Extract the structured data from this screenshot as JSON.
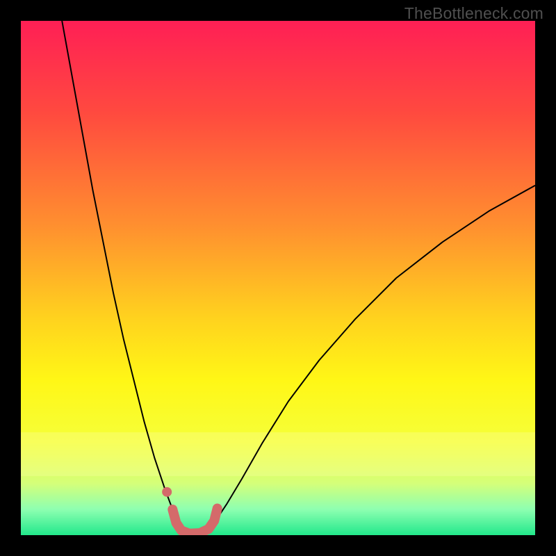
{
  "watermark": "TheBottleneck.com",
  "chart_data": {
    "type": "line",
    "title": "",
    "xlabel": "",
    "ylabel": "",
    "xlim": [
      0,
      100
    ],
    "ylim": [
      0,
      100
    ],
    "background_gradient": {
      "orientation": "vertical",
      "stops": [
        {
          "pos": 0.0,
          "color": "#ff1f55"
        },
        {
          "pos": 0.18,
          "color": "#ff4a3f"
        },
        {
          "pos": 0.4,
          "color": "#ff902f"
        },
        {
          "pos": 0.58,
          "color": "#ffd31e"
        },
        {
          "pos": 0.7,
          "color": "#fff716"
        },
        {
          "pos": 0.82,
          "color": "#f5ff3a"
        },
        {
          "pos": 0.9,
          "color": "#d4ff7a"
        },
        {
          "pos": 0.95,
          "color": "#8dffb1"
        },
        {
          "pos": 1.0,
          "color": "#22e88b"
        }
      ]
    },
    "series": [
      {
        "name": "left-branch",
        "stroke": "#000000",
        "stroke_width": 2,
        "x": [
          8,
          10,
          12,
          14,
          16,
          18,
          20,
          22,
          24,
          26,
          28,
          29.5,
          30.5
        ],
        "y": [
          100,
          89,
          78,
          67,
          57,
          47,
          38,
          30,
          22,
          15,
          9,
          5,
          3
        ]
      },
      {
        "name": "right-branch",
        "stroke": "#000000",
        "stroke_width": 2,
        "x": [
          38,
          40,
          43,
          47,
          52,
          58,
          65,
          73,
          82,
          91,
          100
        ],
        "y": [
          3,
          6,
          11,
          18,
          26,
          34,
          42,
          50,
          57,
          63,
          68
        ]
      },
      {
        "name": "highlight-band",
        "stroke": "#d46a6a",
        "stroke_width": 14,
        "linecap": "round",
        "x": [
          29.5,
          30.2,
          31.2,
          32.8,
          34.8,
          36.5,
          37.6,
          38.2
        ],
        "y": [
          5.0,
          2.4,
          0.9,
          0.3,
          0.4,
          1.2,
          2.8,
          5.2
        ]
      },
      {
        "name": "highlight-dot",
        "type": "scatter",
        "color": "#d46a6a",
        "radius": 7,
        "x": [
          28.4
        ],
        "y": [
          8.4
        ]
      }
    ]
  }
}
